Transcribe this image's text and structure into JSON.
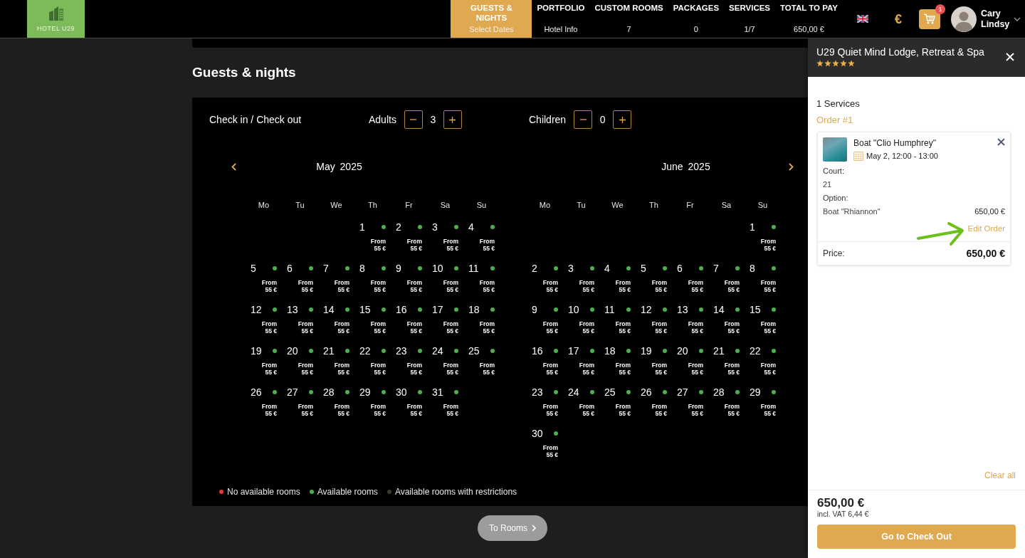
{
  "header": {
    "logo": {
      "text": "HOTEL U29"
    },
    "nav": [
      {
        "label": "GUESTS & NIGHTS",
        "value": "Select Dates",
        "selected": true
      },
      {
        "label": "PORTFOLIO",
        "value": "Hotel Info",
        "selected": false
      },
      {
        "label": "CUSTOM ROOMS",
        "value": "7",
        "selected": false
      },
      {
        "label": "PACKAGES",
        "value": "0",
        "selected": false
      },
      {
        "label": "SERVICES",
        "value": "1/7",
        "selected": false
      },
      {
        "label": "TOTAL TO PAY",
        "value": "650,00 €",
        "selected": false
      }
    ],
    "currency": "€",
    "cart": {
      "count": "1"
    },
    "user": {
      "name": "Cary Lindsy"
    }
  },
  "main": {
    "title": "Guests & nights",
    "dates_label": "Check in / Check out",
    "guests": [
      {
        "label": "Adults",
        "value": "3"
      },
      {
        "label": "Children",
        "value": "0"
      }
    ],
    "months": [
      {
        "title": "May 2025",
        "weekdays": [
          "Mo",
          "Tu",
          "We",
          "Th",
          "Fr",
          "Sa",
          "Su"
        ],
        "weeks": [
          [
            {
              "kind": "blank"
            },
            {
              "kind": "blank"
            },
            {
              "kind": "blank"
            },
            {
              "kind": "day",
              "day": "1",
              "color": "#4caf50",
              "note": "From",
              "price": "55 €"
            },
            {
              "kind": "day",
              "day": "2",
              "color": "#4caf50",
              "note": "From",
              "price": "55 €"
            },
            {
              "kind": "day",
              "day": "3",
              "color": "#4caf50",
              "note": "From",
              "price": "55 €"
            },
            {
              "kind": "day",
              "day": "4",
              "color": "#4caf50",
              "note": "From",
              "price": "55 €"
            }
          ],
          [
            {
              "kind": "day",
              "day": "5",
              "color": "#4caf50",
              "note": "From",
              "price": "55 €"
            },
            {
              "kind": "day",
              "day": "6",
              "color": "#4caf50",
              "note": "From",
              "price": "55 €"
            },
            {
              "kind": "day",
              "day": "7",
              "color": "#4caf50",
              "note": "From",
              "price": "55 €"
            },
            {
              "kind": "day",
              "day": "8",
              "color": "#4caf50",
              "note": "From",
              "price": "55 €"
            },
            {
              "kind": "day",
              "day": "9",
              "color": "#4caf50",
              "note": "From",
              "price": "55 €"
            },
            {
              "kind": "day",
              "day": "10",
              "color": "#4caf50",
              "note": "From",
              "price": "55 €"
            },
            {
              "kind": "day",
              "day": "11",
              "color": "#4caf50",
              "note": "From",
              "price": "55 €"
            }
          ],
          [
            {
              "kind": "day",
              "day": "12",
              "color": "#4caf50",
              "note": "From",
              "price": "55 €"
            },
            {
              "kind": "day",
              "day": "13",
              "color": "#4caf50",
              "note": "From",
              "price": "55 €"
            },
            {
              "kind": "day",
              "day": "14",
              "color": "#4caf50",
              "note": "From",
              "price": "55 €"
            },
            {
              "kind": "day",
              "day": "15",
              "color": "#4caf50",
              "note": "From",
              "price": "55 €"
            },
            {
              "kind": "day",
              "day": "16",
              "color": "#4caf50",
              "note": "From",
              "price": "55 €"
            },
            {
              "kind": "day",
              "day": "17",
              "color": "#4caf50",
              "note": "From",
              "price": "55 €"
            },
            {
              "kind": "day",
              "day": "18",
              "color": "#4caf50",
              "note": "From",
              "price": "55 €"
            }
          ],
          [
            {
              "kind": "day",
              "day": "19",
              "color": "#4caf50",
              "note": "From",
              "price": "55 €"
            },
            {
              "kind": "day",
              "day": "20",
              "color": "#4caf50",
              "note": "From",
              "price": "55 €"
            },
            {
              "kind": "day",
              "day": "21",
              "color": "#4caf50",
              "note": "From",
              "price": "55 €"
            },
            {
              "kind": "day",
              "day": "22",
              "color": "#4caf50",
              "note": "From",
              "price": "55 €"
            },
            {
              "kind": "day",
              "day": "23",
              "color": "#4caf50",
              "note": "From",
              "price": "55 €"
            },
            {
              "kind": "day",
              "day": "24",
              "color": "#4caf50",
              "note": "From",
              "price": "55 €"
            },
            {
              "kind": "day",
              "day": "25",
              "color": "#4caf50",
              "note": "From",
              "price": "55 €"
            }
          ],
          [
            {
              "kind": "day",
              "day": "26",
              "color": "#4caf50",
              "note": "From",
              "price": "55 €"
            },
            {
              "kind": "day",
              "day": "27",
              "color": "#4caf50",
              "note": "From",
              "price": "55 €"
            },
            {
              "kind": "day",
              "day": "28",
              "color": "#4caf50",
              "note": "From",
              "price": "55 €"
            },
            {
              "kind": "day",
              "day": "29",
              "color": "#4caf50",
              "note": "From",
              "price": "55 €"
            },
            {
              "kind": "day",
              "day": "30",
              "color": "#4caf50",
              "note": "From",
              "price": "55 €"
            },
            {
              "kind": "day",
              "day": "31",
              "color": "#4caf50",
              "note": "From",
              "price": "55 €"
            },
            {
              "kind": "blank"
            }
          ]
        ]
      },
      {
        "title": "June 2025",
        "weekdays": [
          "Mo",
          "Tu",
          "We",
          "Th",
          "Fr",
          "Sa",
          "Su"
        ],
        "weeks": [
          [
            {
              "kind": "blank"
            },
            {
              "kind": "blank"
            },
            {
              "kind": "blank"
            },
            {
              "kind": "blank"
            },
            {
              "kind": "blank"
            },
            {
              "kind": "blank"
            },
            {
              "kind": "day",
              "day": "1",
              "color": "#4caf50",
              "note": "From",
              "price": "55 €"
            }
          ],
          [
            {
              "kind": "day",
              "day": "2",
              "color": "#4caf50",
              "note": "From",
              "price": "55 €"
            },
            {
              "kind": "day",
              "day": "3",
              "color": "#4caf50",
              "note": "From",
              "price": "55 €"
            },
            {
              "kind": "day",
              "day": "4",
              "color": "#4caf50",
              "note": "From",
              "price": "55 €"
            },
            {
              "kind": "day",
              "day": "5",
              "color": "#4caf50",
              "note": "From",
              "price": "55 €"
            },
            {
              "kind": "day",
              "day": "6",
              "color": "#4caf50",
              "note": "From",
              "price": "55 €"
            },
            {
              "kind": "day",
              "day": "7",
              "color": "#4caf50",
              "note": "From",
              "price": "55 €"
            },
            {
              "kind": "day",
              "day": "8",
              "color": "#4caf50",
              "note": "From",
              "price": "55 €"
            }
          ],
          [
            {
              "kind": "day",
              "day": "9",
              "color": "#4caf50",
              "note": "From",
              "price": "55 €"
            },
            {
              "kind": "day",
              "day": "10",
              "color": "#4caf50",
              "note": "From",
              "price": "55 €"
            },
            {
              "kind": "day",
              "day": "11",
              "color": "#4caf50",
              "note": "From",
              "price": "55 €"
            },
            {
              "kind": "day",
              "day": "12",
              "color": "#4caf50",
              "note": "From",
              "price": "55 €"
            },
            {
              "kind": "day",
              "day": "13",
              "color": "#4caf50",
              "note": "From",
              "price": "55 €"
            },
            {
              "kind": "day",
              "day": "14",
              "color": "#4caf50",
              "note": "From",
              "price": "55 €"
            },
            {
              "kind": "day",
              "day": "15",
              "color": "#4caf50",
              "note": "From",
              "price": "55 €"
            }
          ],
          [
            {
              "kind": "day",
              "day": "16",
              "color": "#4caf50",
              "note": "From",
              "price": "55 €"
            },
            {
              "kind": "day",
              "day": "17",
              "color": "#4caf50",
              "note": "From",
              "price": "55 €"
            },
            {
              "kind": "day",
              "day": "18",
              "color": "#4caf50",
              "note": "From",
              "price": "55 €"
            },
            {
              "kind": "day",
              "day": "19",
              "color": "#4caf50",
              "note": "From",
              "price": "55 €"
            },
            {
              "kind": "day",
              "day": "20",
              "color": "#4caf50",
              "note": "From",
              "price": "55 €"
            },
            {
              "kind": "day",
              "day": "21",
              "color": "#4caf50",
              "note": "From",
              "price": "55 €"
            },
            {
              "kind": "day",
              "day": "22",
              "color": "#4caf50",
              "note": "From",
              "price": "55 €"
            }
          ],
          [
            {
              "kind": "day",
              "day": "23",
              "color": "#4caf50",
              "note": "From",
              "price": "55 €"
            },
            {
              "kind": "day",
              "day": "24",
              "color": "#4caf50",
              "note": "From",
              "price": "55 €"
            },
            {
              "kind": "day",
              "day": "25",
              "color": "#4caf50",
              "note": "From",
              "price": "55 €"
            },
            {
              "kind": "day",
              "day": "26",
              "color": "#4caf50",
              "note": "From",
              "price": "55 €"
            },
            {
              "kind": "day",
              "day": "27",
              "color": "#4caf50",
              "note": "From",
              "price": "55 €"
            },
            {
              "kind": "day",
              "day": "28",
              "color": "#4caf50",
              "note": "From",
              "price": "55 €"
            },
            {
              "kind": "day",
              "day": "29",
              "color": "#4caf50",
              "note": "From",
              "price": "55 €"
            }
          ],
          [
            {
              "kind": "day",
              "day": "30",
              "color": "#4caf50",
              "note": "From",
              "price": "55 €"
            },
            {
              "kind": "blank"
            },
            {
              "kind": "blank"
            },
            {
              "kind": "blank"
            },
            {
              "kind": "blank"
            },
            {
              "kind": "blank"
            },
            {
              "kind": "blank"
            }
          ]
        ]
      }
    ],
    "legend": [
      {
        "label": "No available rooms",
        "color": "#e53935"
      },
      {
        "label": "Available rooms",
        "color": "#4caf50"
      },
      {
        "label": "Available rooms with restrictions",
        "color": "#3b3a28"
      }
    ],
    "next_button": {
      "label": "To Rooms",
      "disabled": true
    }
  },
  "cart_panel": {
    "hotel": "U29 Quiet Mind Lodge, Retreat & Spa",
    "stars": 5,
    "services_count": "1 Services",
    "order_title": "Order #1",
    "items": [
      {
        "title": "Boat \"Clio Humphrey\"",
        "date": "May 2, 12:00 - 13:00",
        "details": [
          {
            "label": "Court:",
            "value": "21"
          },
          {
            "label": "Option:",
            "value": "Boat \"Rhiannon\"",
            "price": "650,00 €"
          }
        ],
        "edit": "Edit Order",
        "price_label": "Price:",
        "price": "650,00 €"
      }
    ],
    "clear": "Clear all",
    "total": "650,00 €",
    "vat": "incl. VAT 6,44 €",
    "checkout": "Go to Check Out"
  }
}
